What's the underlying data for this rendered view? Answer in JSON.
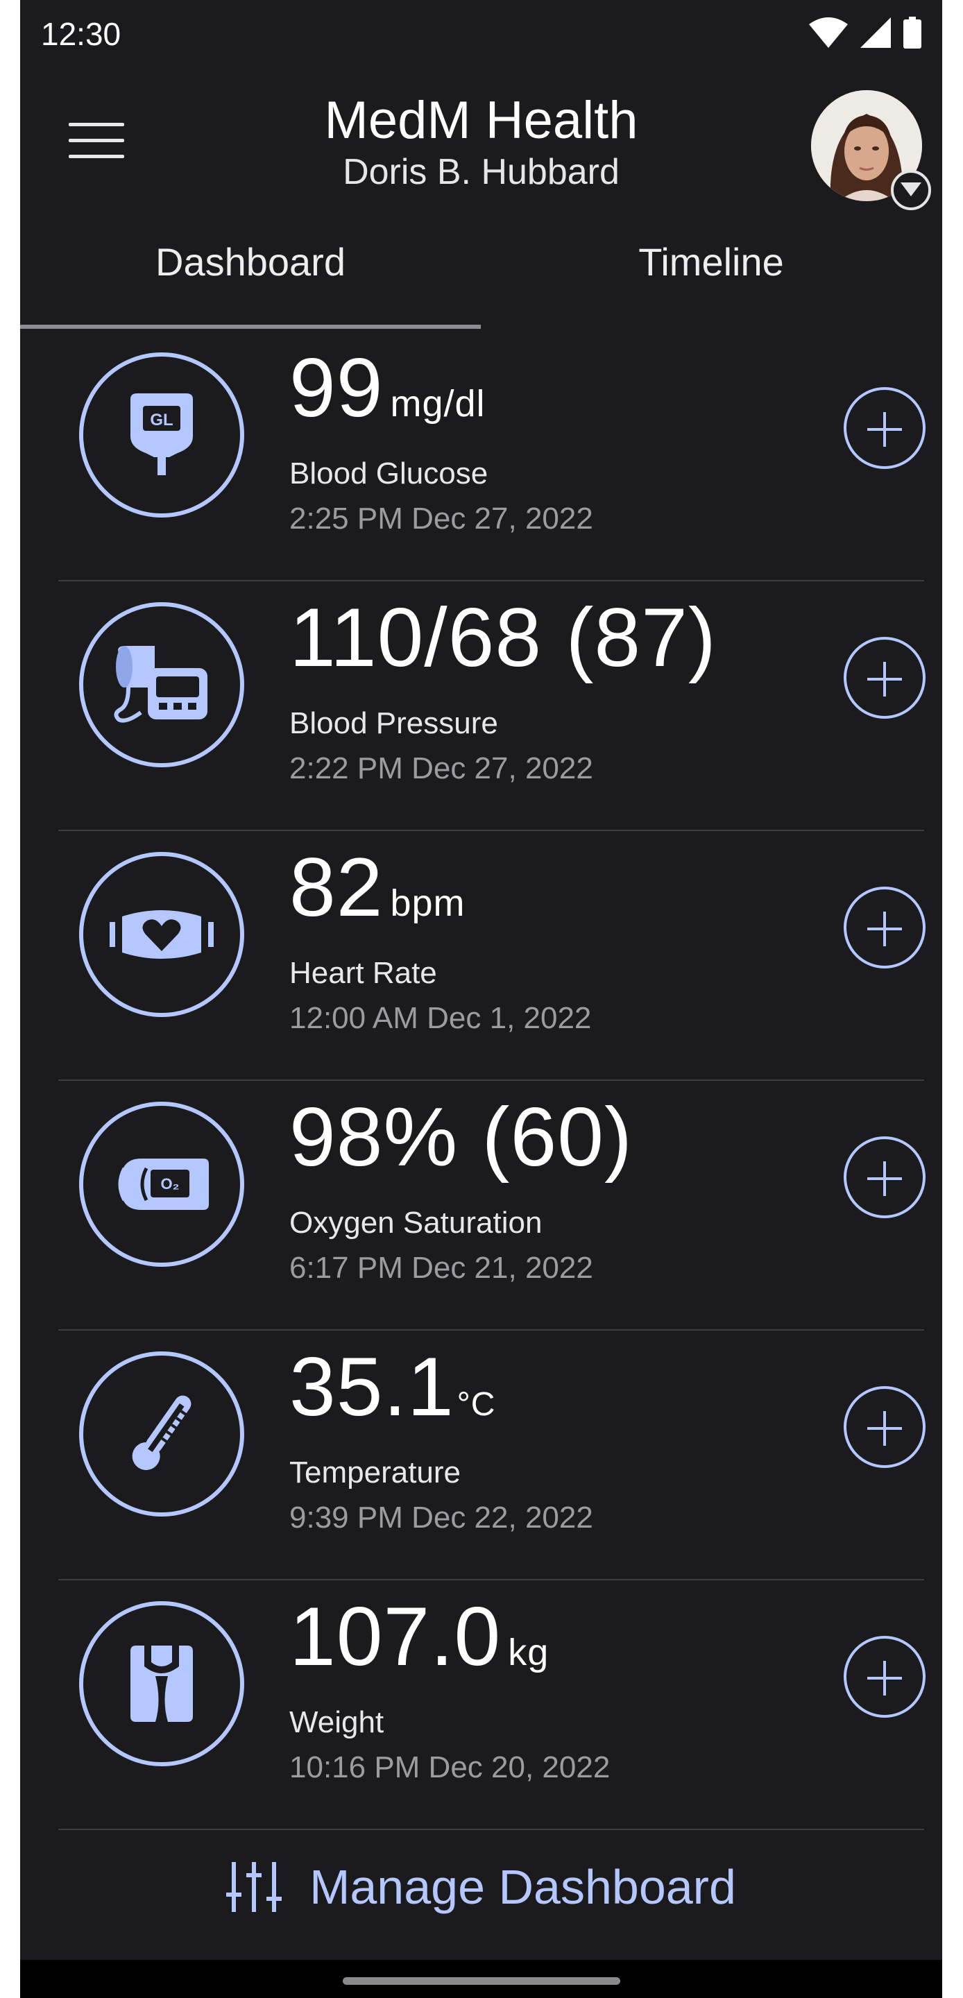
{
  "status_bar": {
    "time": "12:30"
  },
  "header": {
    "title": "MedM Health",
    "user_name": "Doris B. Hubbard"
  },
  "tabs": [
    {
      "label": "Dashboard",
      "active": true
    },
    {
      "label": "Timeline",
      "active": false
    }
  ],
  "cards": [
    {
      "value": "99",
      "unit": "mg/dl",
      "name": "Blood Glucose",
      "time": "2:25 PM Dec 27, 2022",
      "icon": "glucose-meter-icon"
    },
    {
      "value": "110/68 (87)",
      "unit": "",
      "name": "Blood Pressure",
      "time": "2:22 PM Dec 27, 2022",
      "icon": "blood-pressure-monitor-icon"
    },
    {
      "value": "82",
      "unit": "bpm",
      "name": "Heart Rate",
      "time": "12:00 AM Dec 1, 2022",
      "icon": "heart-rate-strap-icon"
    },
    {
      "value": "98% (60)",
      "unit": "",
      "name": "Oxygen Saturation",
      "time": "6:17 PM Dec 21, 2022",
      "icon": "pulse-oximeter-icon"
    },
    {
      "value": "35.1",
      "unit": "°C",
      "name": "Temperature",
      "time": "9:39 PM Dec 22, 2022",
      "icon": "thermometer-icon"
    },
    {
      "value": "107.0",
      "unit": "kg",
      "name": "Weight",
      "time": "10:16 PM Dec 20, 2022",
      "icon": "scale-icon"
    }
  ],
  "glucose_icon_text": "GL",
  "oximeter_icon_text": "O₂",
  "manage": {
    "label": "Manage Dashboard"
  },
  "colors": {
    "accent": "#b4c7ff",
    "background": "#1b1b1e",
    "divider": "#3b3c42"
  }
}
